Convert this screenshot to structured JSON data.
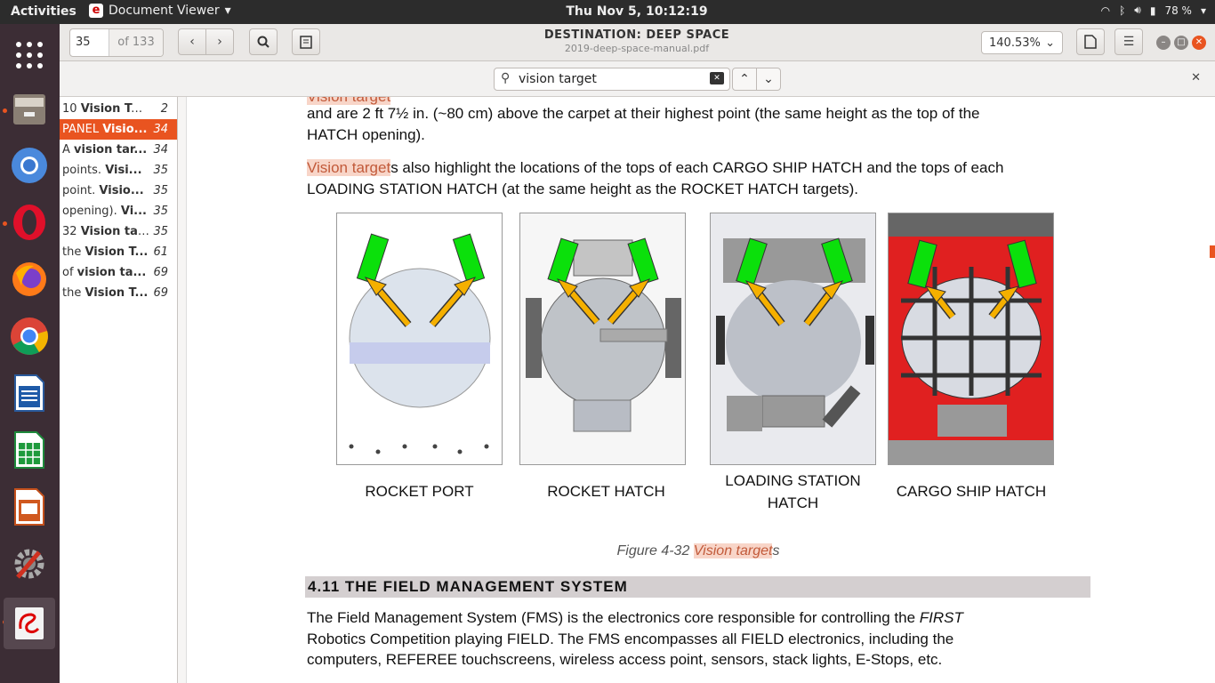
{
  "topbar": {
    "activities": "Activities",
    "app_name": "Document Viewer",
    "clock": "Thu Nov  5, 10:12:19",
    "battery": "78 %"
  },
  "header": {
    "page_current": "35",
    "page_total": "of 133",
    "title": "DESTINATION: DEEP SPACE",
    "filename": "2019-deep-space-manual.pdf",
    "zoom": "140.53%"
  },
  "find": {
    "query": "vision target"
  },
  "results": [
    {
      "pre": "10 ",
      "bold": "Vision Ta...",
      "page": "2"
    },
    {
      "pre": "PANEL ",
      "bold": "Visio...",
      "page": "34"
    },
    {
      "pre": "A ",
      "bold": "vision tar...",
      "page": "34"
    },
    {
      "pre": "points. ",
      "bold": "Visi...",
      "page": "35"
    },
    {
      "pre": "point. ",
      "bold": "Visio...",
      "page": "35"
    },
    {
      "pre": "opening). ",
      "bold": "Vi...",
      "page": "35"
    },
    {
      "pre": "32 ",
      "bold": "Vision ta...",
      "page": "35"
    },
    {
      "pre": "the ",
      "bold": "Vision T...",
      "page": "61"
    },
    {
      "pre": "of ",
      "bold": "vision ta...",
      "page": "69"
    },
    {
      "pre": "the ",
      "bold": "Vision T...",
      "page": "69"
    }
  ],
  "doc": {
    "p1_line1": "and are 2 ft 7½ in. (~80 cm) above the carpet at their highest point (the same height as the top of the",
    "p1_line2": "HATCH opening).",
    "p2_hl": "Vision target",
    "p2_rest": "s also highlight the locations of the tops of each CARGO SHIP HATCH and the tops of each",
    "p2_line2": "LOADING STATION HATCH (at the same height as the ROCKET HATCH targets).",
    "cap1": "ROCKET PORT",
    "cap2": "ROCKET HATCH",
    "cap3a": "LOADING STATION",
    "cap3b": "HATCH",
    "cap4": "CARGO SHIP HATCH",
    "figcap_pre": "Figure 4-32 ",
    "figcap_hl": "Vision target",
    "figcap_post": "s",
    "section": "4.11 THE FIELD MANAGEMENT SYSTEM",
    "p3_l1_pre": "The Field Management System (FMS) is the electronics core responsible for controlling the ",
    "p3_l1_it": "FIRST",
    "p3_l2": "Robotics Competition playing FIELD. The FMS encompasses all FIELD electronics, including the",
    "p3_l3": "computers, REFEREE touchscreens, wireless access point, sensors, stack lights, E-Stops, etc."
  },
  "colors": {
    "accent": "#e95420",
    "target": "#00e000",
    "arrow": "#f5b000",
    "cargo_red": "#e02020"
  }
}
